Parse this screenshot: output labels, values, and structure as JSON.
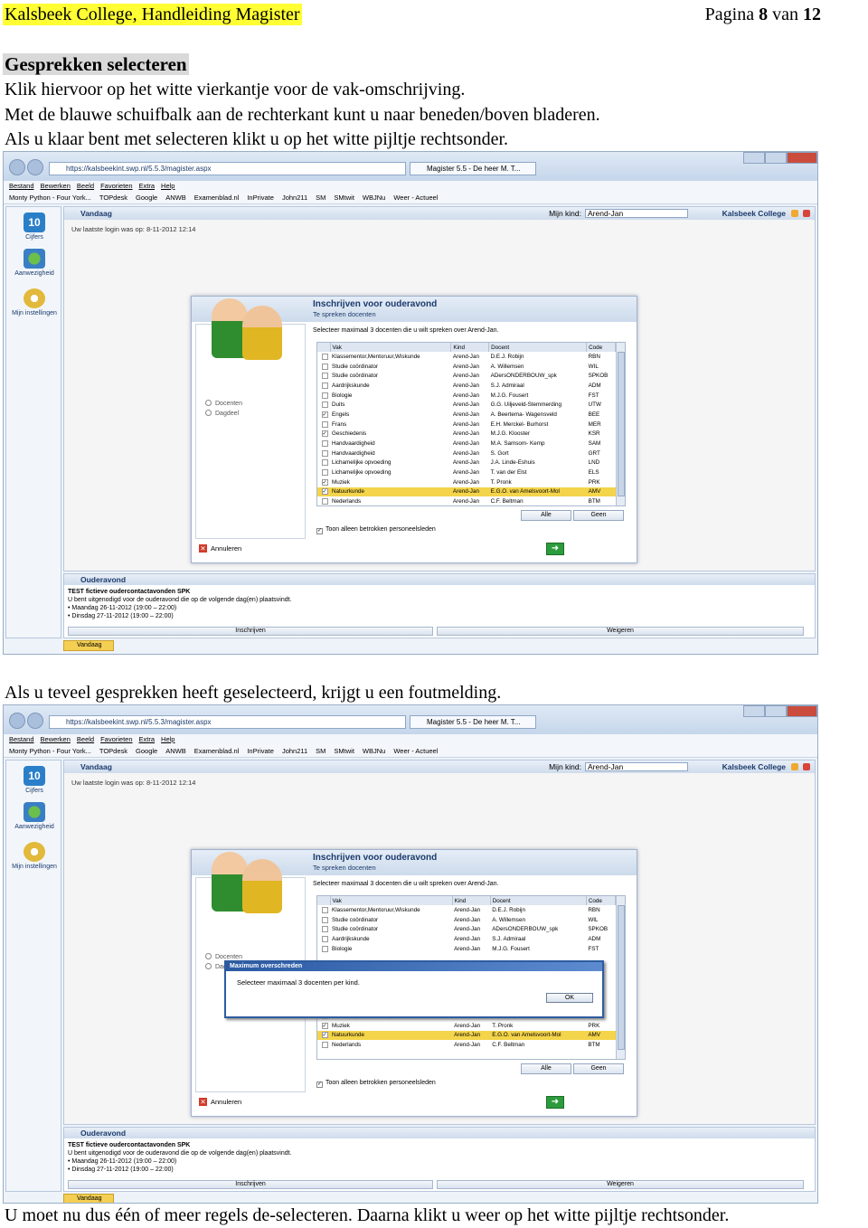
{
  "header": {
    "left": "Kalsbeek College, Handleiding Magister",
    "page_prefix": "Pagina",
    "page_num": "8",
    "page_mid": "van",
    "page_total": "12"
  },
  "section_title": "Gesprekken selecteren",
  "paragraphs": [
    "Klik hiervoor op het witte vierkantje voor de vak-omschrijving.",
    "Met de blauwe schuifbalk aan de rechterkant kunt u naar beneden/boven bladeren.",
    "Als u klaar bent met selecteren klikt u op het witte pijltje rechtsonder.",
    "Als u teveel gesprekken heeft geselecteerd, krijgt u een foutmelding.",
    "U moet nu dus één of meer regels de-selecteren. Daarna klikt u weer op het witte pijltje rechtsonder."
  ],
  "browser": {
    "address": "https://kalsbeekint.swp.nl/5.5.3/magister.aspx",
    "tab": "Magister 5.5 - De heer M. T...",
    "menu": [
      "Bestand",
      "Bewerken",
      "Beeld",
      "Favorieten",
      "Extra",
      "Help"
    ],
    "favorites": [
      "Monty Python - Four York...",
      "TOPdesk",
      "Google",
      "ANWB",
      "Examenblad.nl",
      "InPrivate",
      "John211",
      "SM",
      "SMtwit",
      "WBJNu",
      "Weer - Actueel"
    ]
  },
  "app": {
    "nav": [
      "Cijfers",
      "Aanwezigheid",
      "Mijn instellingen"
    ],
    "nav_badge": "10",
    "view_title": "Vandaag",
    "kind_label": "Mijn kind:",
    "kind_value": "Arend-Jan",
    "school": "Kalsbeek College",
    "last_login": "Uw laatste login was op: 8-11-2012 12:14",
    "dialog": {
      "title": "Inschrijven voor ouderavond",
      "subtitle": "Te spreken docenten",
      "hint": "Selecteer maximaal 3 docenten die u wilt spreken over Arend-Jan.",
      "radio_options": [
        "Docenten",
        "Dagdeel"
      ],
      "columns": [
        "Vak",
        "Kind",
        "Docent",
        "Code"
      ],
      "rows": [
        {
          "check": "",
          "vak": "Klassementor,Mentoruur,Wiskunde",
          "kind": "Arend-Jan",
          "docent": "D.E.J. Robijn",
          "code": "RBN"
        },
        {
          "check": "",
          "vak": "Studie coördinator",
          "kind": "Arend-Jan",
          "docent": "A. Willemsen",
          "code": "WIL"
        },
        {
          "check": "",
          "vak": "Studie coördinator",
          "kind": "Arend-Jan",
          "docent": "ADersONDERBOUW_spk",
          "code": "SPKOB"
        },
        {
          "check": "",
          "vak": "Aardrijkskunde",
          "kind": "Arend-Jan",
          "docent": "S.J. Admiraal",
          "code": "ADM"
        },
        {
          "check": "",
          "vak": "Biologie",
          "kind": "Arend-Jan",
          "docent": "M.J.G. Fousert",
          "code": "FST"
        },
        {
          "check": "",
          "vak": "Duits",
          "kind": "Arend-Jan",
          "docent": "G.G. Uiljeveld-Stemmerding",
          "code": "UTW"
        },
        {
          "check": "✓",
          "vak": "Engels",
          "kind": "Arend-Jan",
          "docent": "A. Beertema- Wagensveld",
          "code": "BEE"
        },
        {
          "check": "",
          "vak": "Frans",
          "kind": "Arend-Jan",
          "docent": "E.H. Merckel- Burhorst",
          "code": "MER"
        },
        {
          "check": "✓",
          "vak": "Geschiedenis",
          "kind": "Arend-Jan",
          "docent": "M.J.G. Klooster",
          "code": "KSR"
        },
        {
          "check": "",
          "vak": "Handvaardigheid",
          "kind": "Arend-Jan",
          "docent": "M.A. Samsom- Kemp",
          "code": "SAM"
        },
        {
          "check": "",
          "vak": "Handvaardigheid",
          "kind": "Arend-Jan",
          "docent": "S. Gort",
          "code": "GRT"
        },
        {
          "check": "",
          "vak": "Lichamelijke opvoeding",
          "kind": "Arend-Jan",
          "docent": "J.A. Linde-Eshuis",
          "code": "LND"
        },
        {
          "check": "",
          "vak": "Lichamelijke opvoeding",
          "kind": "Arend-Jan",
          "docent": "T. van der Elst",
          "code": "ELS"
        },
        {
          "check": "✓",
          "vak": "Muziek",
          "kind": "Arend-Jan",
          "docent": "T. Pronk",
          "code": "PRK"
        },
        {
          "check": "✓",
          "vak": "Natuurkunde",
          "kind": "Arend-Jan",
          "docent": "E.G.O. van Amelsvoort-Mol",
          "code": "AMV"
        },
        {
          "check": "",
          "vak": "Nederlands",
          "kind": "Arend-Jan",
          "docent": "C.F. Beltman",
          "code": "BTM"
        }
      ],
      "btn_all": "Alle",
      "btn_none": "Geen",
      "show_only": "Toon alleen betrokken personeelsleden",
      "cancel": "Annuleren"
    },
    "ouderavond": {
      "title": "Ouderavond",
      "event": "TEST fictieve oudercontactavonden SPK",
      "text": "U bent uitgenodigd voor de ouderavond die op de volgende dag(en) plaatsvindt.",
      "dates": [
        "Maandag 26-11-2012 (19:00 – 22:00)",
        "Dinsdag 27-11-2012 (19:00 – 22:00)"
      ],
      "btn_accept": "Inschrijven",
      "btn_decline": "Weigeren"
    },
    "taskbar": "Vandaag",
    "error": {
      "title": "Maximum overschreden",
      "message": "Selecteer maximaal 3 docenten per kind.",
      "ok": "OK"
    }
  }
}
